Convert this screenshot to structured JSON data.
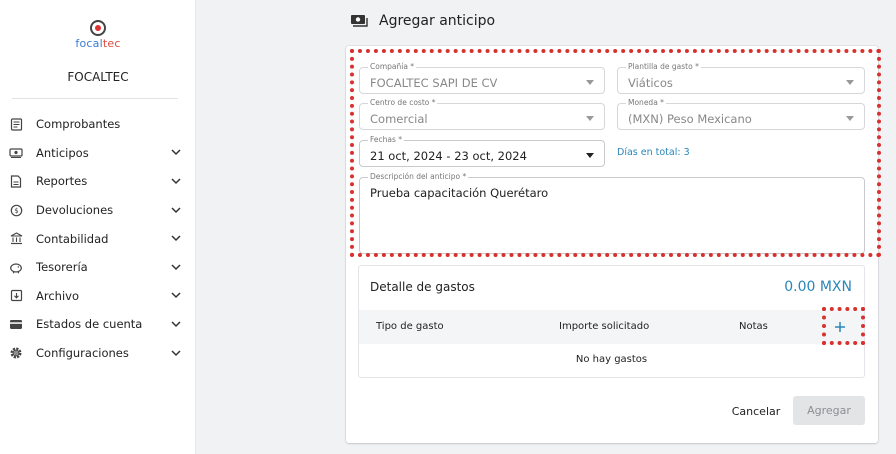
{
  "brand": {
    "logo_prefix": "focal",
    "logo_suffix": "tec",
    "company": "FOCALTEC"
  },
  "nav": [
    {
      "label": "Comprobantes",
      "icon": "receipt-icon",
      "has_children": false
    },
    {
      "label": "Anticipos",
      "icon": "cash-icon",
      "has_children": true
    },
    {
      "label": "Reportes",
      "icon": "report-icon",
      "has_children": true
    },
    {
      "label": "Devoluciones",
      "icon": "refund-icon",
      "has_children": true
    },
    {
      "label": "Contabilidad",
      "icon": "bank-icon",
      "has_children": true
    },
    {
      "label": "Tesorería",
      "icon": "piggy-bank-icon",
      "has_children": true
    },
    {
      "label": "Archivo",
      "icon": "archive-icon",
      "has_children": true
    },
    {
      "label": "Estados de cuenta",
      "icon": "card-icon",
      "has_children": true
    },
    {
      "label": "Configuraciones",
      "icon": "gear-icon",
      "has_children": true
    }
  ],
  "page": {
    "title": "Agregar anticipo",
    "icon": "cash-icon"
  },
  "form": {
    "company": {
      "label": "Compañía *",
      "value": "FOCALTEC SAPI DE CV"
    },
    "template": {
      "label": "Plantilla de gasto *",
      "value": "Viáticos"
    },
    "cost_center": {
      "label": "Centro de costo *",
      "value": "Comercial"
    },
    "currency": {
      "label": "Moneda *",
      "value": "(MXN) Peso Mexicano"
    },
    "dates": {
      "label": "Fechas *",
      "value": "21 oct, 2024 - 23 oct, 2024"
    },
    "days_total_label": "Días en total:",
    "days_total_value": "3",
    "description": {
      "label": "Descripción del anticipo *",
      "value": "Prueba capacitación Querétaro"
    }
  },
  "detail": {
    "title": "Detalle de gastos",
    "total": "0.00 MXN",
    "columns": [
      "Tipo de gasto",
      "Importe solicitado",
      "Notas"
    ],
    "add_symbol": "+",
    "empty_text": "No hay gastos"
  },
  "actions": {
    "cancel": "Cancelar",
    "submit": "Agregar"
  },
  "colors": {
    "accent": "#2b86b8",
    "highlight": "#d8322e",
    "disabled_bg": "#e3e4e6"
  }
}
